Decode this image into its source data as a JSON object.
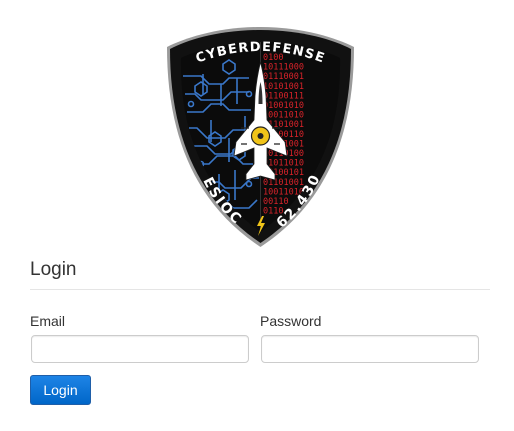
{
  "logo": {
    "top_text": "CYBERDEFENSE",
    "left_text": "ESIOC",
    "right_text": "62.430",
    "binary_rows": [
      "0100",
      "10111000",
      "01110001",
      "10101001",
      "01100111",
      "01001010",
      "10011010",
      "01101001",
      "10100110",
      "01011001",
      "10110100",
      "01011010",
      "10100101",
      "01101001",
      "10011010",
      "00110",
      "0110"
    ],
    "colors": {
      "shield_outer": "#111111",
      "shield_rim": "#9a9a9a",
      "circuit_blue": "#3a77c9",
      "binary_red": "#d8232a",
      "jet_white": "#ffffff",
      "lightning_yellow": "#f0c419"
    }
  },
  "login": {
    "title": "Login"
  },
  "form": {
    "email_label": "Email",
    "email_value": "",
    "email_placeholder": "",
    "password_label": "Password",
    "password_value": "",
    "password_placeholder": "",
    "submit_label": "Login"
  }
}
